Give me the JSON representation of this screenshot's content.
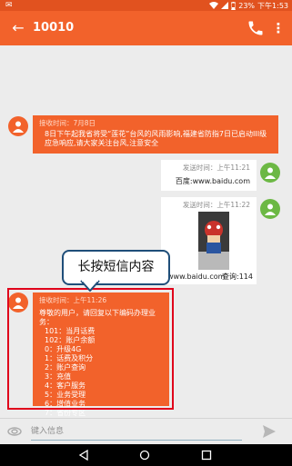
{
  "status_bar": {
    "battery": "23%",
    "time": "下午1:53"
  },
  "app_bar": {
    "title": "10010"
  },
  "messages": [
    {
      "direction": "incoming",
      "meta": "接收时间：7月8日",
      "text": "8日下午起我省将受“莲花”台风的风雨影响,福建省防指7日已启动III级应急响应,请大家关注台风,注意安全"
    },
    {
      "direction": "outgoing",
      "meta": "发送时间：上午11:21",
      "text": "百度:www.baidu.com"
    },
    {
      "direction": "outgoing",
      "meta": "发送时间：上午11:22",
      "text": "www.baidu.com",
      "extra": "查询:114"
    },
    {
      "direction": "incoming",
      "meta": "接收时间：上午11:26",
      "intro": "尊敬的用户，请回复以下编码办理业务：",
      "options": [
        "101：当月话费",
        "102：账户余额",
        "0：升级4G",
        "1：话费及积分",
        "2：账户查询",
        "3：充值",
        "4：客户服务",
        "5：业务受理",
        "6：增值业务",
        "7：省份专区",
        "9：流量包"
      ]
    }
  ],
  "callout": {
    "text": "长按短信内容"
  },
  "compose": {
    "placeholder": "键入信息"
  },
  "colors": {
    "accent": "#f2622b",
    "statusbar": "#e1521f",
    "highlight": "#e0001b",
    "callout_border": "#1f4e79"
  }
}
